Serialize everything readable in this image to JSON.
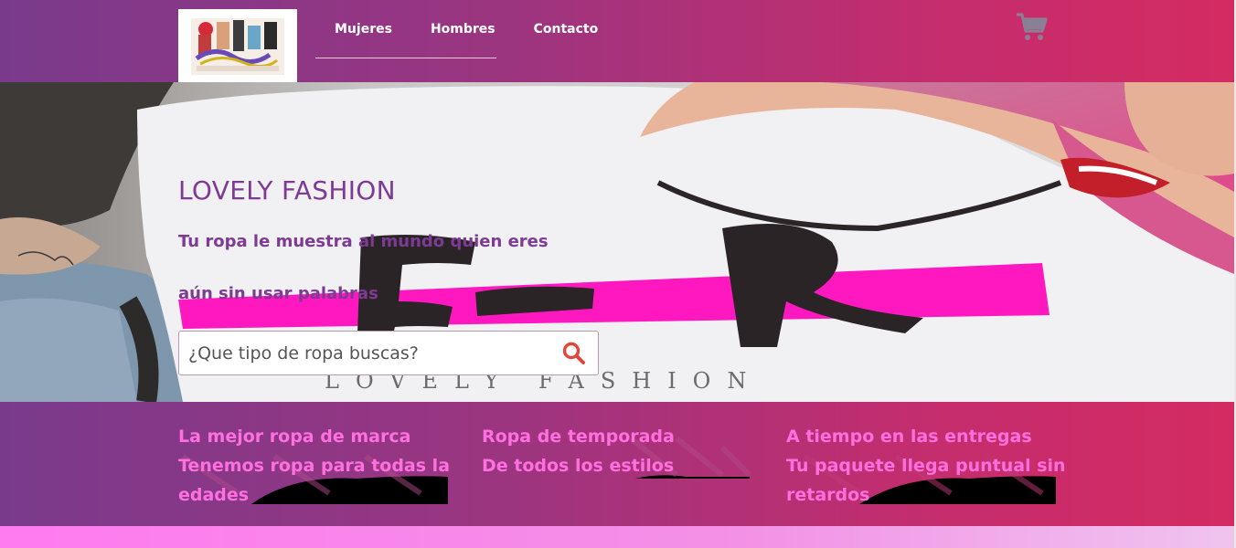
{
  "nav": {
    "items": [
      {
        "label": "Mujeres"
      },
      {
        "label": "Hombres"
      },
      {
        "label": "Contacto"
      }
    ]
  },
  "hero": {
    "title": "LOVELY FASHION",
    "subtitle_line1": "Tu ropa le muestra al mundo quien eres",
    "subtitle_line2": "aún sin usar palabras",
    "shirt_text": "LOVELY FASHION",
    "search": {
      "placeholder": "¿Que tipo de ropa buscas?"
    }
  },
  "features": [
    {
      "line1": "La mejor ropa de marca",
      "line2": "Tenemos ropa para todas la",
      "line3": "edades"
    },
    {
      "line1": "Ropa de temporada",
      "line2": "De todos los estilos",
      "line3": ""
    },
    {
      "line1": "A tiempo en las entregas",
      "line2": "Tu paquete llega puntual sin",
      "line3": "retardos"
    }
  ],
  "colors": {
    "header_start": "#7a3a8c",
    "header_end": "#d42b62",
    "hero_text": "#7d3b93",
    "feature_text": "#ff6fe0",
    "search_icon": "#e0463c"
  },
  "icons": {
    "cart": "cart-icon",
    "search": "search-icon"
  }
}
